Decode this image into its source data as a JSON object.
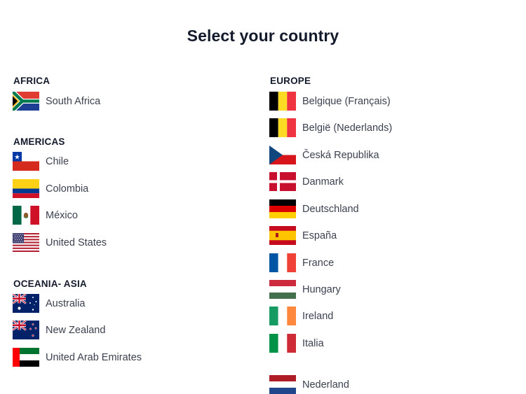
{
  "page": {
    "title": "Select your country"
  },
  "regions": {
    "africa": {
      "title": "AFRICA",
      "countries": [
        "South Africa"
      ]
    },
    "americas": {
      "title": "AMERICAS",
      "countries": [
        "Chile",
        "Colombia",
        "México",
        "United States"
      ]
    },
    "oceania": {
      "title": "OCEANIA- ASIA",
      "countries": [
        "Australia",
        "New Zealand",
        "United Arab Emirates"
      ]
    },
    "europe": {
      "title": "EUROPE",
      "countries": [
        "Belgique (Français)",
        "België (Nederlands)",
        "Česká Republika",
        "Danmark",
        "Deutschland",
        "España",
        "France",
        "Hungary",
        "Ireland",
        "Italia",
        "Nederland"
      ]
    }
  }
}
